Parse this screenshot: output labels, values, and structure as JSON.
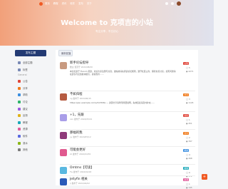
{
  "header": {
    "nav": [
      "首页",
      "教程",
      "资讯",
      "软件",
      "发布",
      "关于"
    ],
    "title": "Welcome to 克项吉的小站",
    "subtitle": "专注分享，不忘初心"
  },
  "sidebar": {
    "new_post_label": "发布主题",
    "top_items": [
      {
        "label": "全部主题",
        "color": "#7a8ab5"
      },
      {
        "label": "标签",
        "color": "#7a8ab5"
      }
    ],
    "group_label": "General",
    "items": [
      {
        "label": "公告",
        "color": "#e0463a"
      },
      {
        "label": "分享",
        "color": "#f07a1a"
      },
      {
        "label": "求助",
        "color": "#3a8ee0"
      },
      {
        "label": "讨论",
        "color": "#2fb46b"
      },
      {
        "label": "建议",
        "color": "#9a5ae0"
      },
      {
        "label": "反馈",
        "color": "#e0b21a"
      },
      {
        "label": "教程",
        "color": "#1aa8b8"
      },
      {
        "label": "资源",
        "color": "#e05a9a"
      },
      {
        "label": "软件",
        "color": "#5a6ae0"
      },
      {
        "label": "灌水",
        "color": "#8ab81a"
      },
      {
        "label": "其他",
        "color": "#7a7a7a"
      }
    ]
  },
  "main": {
    "sort_label": "最新回复",
    "posts": [
      {
        "title": "新手论坛指导",
        "meta": "楼主 置顶于 2024/08/20",
        "body": "本论坛基于 Flarum 搭建，欢迎大家注册与交流。发帖前请先阅读论坛规则，遵守社区公约，保持友善讨论。如有问题请在建议与反馈板块留言，感谢支持……",
        "tag": "公告",
        "tag_color": "#e0463a",
        "avatar_color": "#c89a80",
        "replies": "5",
        "views": "2271"
      },
      {
        "title": "不如归程",
        "meta": "ng 发布于 2024/06/15",
        "body": "https://pan.example.com/s/OnHDNv — 资源分享请附带简要说明，失效链接请及时补充……",
        "tag": "分享",
        "tag_color": "#f07a1a",
        "avatar_color": "#b55a40",
        "replies": "3",
        "views": "1126"
      },
      {
        "title": "+1，先跟",
        "meta": "xxx 发布于 2024/05/21",
        "body": "",
        "tag": "讨论",
        "tag_color": "#e0463a",
        "avatar_color": "#a99ee8",
        "replies": "1",
        "views": "451"
      },
      {
        "title": "那幅的我",
        "meta": "yy 发布于 2024/05/12",
        "body": "",
        "tag": "分享",
        "tag_color": "#f07a1a",
        "avatar_color": "#8f3a7a",
        "replies": "2",
        "views": "397"
      },
      {
        "title": "可能会更好",
        "meta": "zz 发布于 2024/04/30",
        "body": "",
        "tag": "求助",
        "tag_color": "#3a8ee0",
        "avatar_color": "#e05a8f",
        "replies": "4",
        "views": "268"
      },
      {
        "title": "Omtrns【可读】",
        "meta": "Fw 发布于 2024/04/18",
        "body": "",
        "tag": "教程",
        "tag_color": "#1aa8b8",
        "avatar_color": "#5ab8e0",
        "replies": "0",
        "views": "172"
      },
      {
        "title": "Jellyfin 相关",
        "meta": "jl 发布于 2024/04/02",
        "body": "",
        "tag": "资源",
        "tag_color": "#e05a9a",
        "avatar_color": "#2a5ab8",
        "replies": "1",
        "views": "145"
      }
    ]
  },
  "fab_label": "+"
}
